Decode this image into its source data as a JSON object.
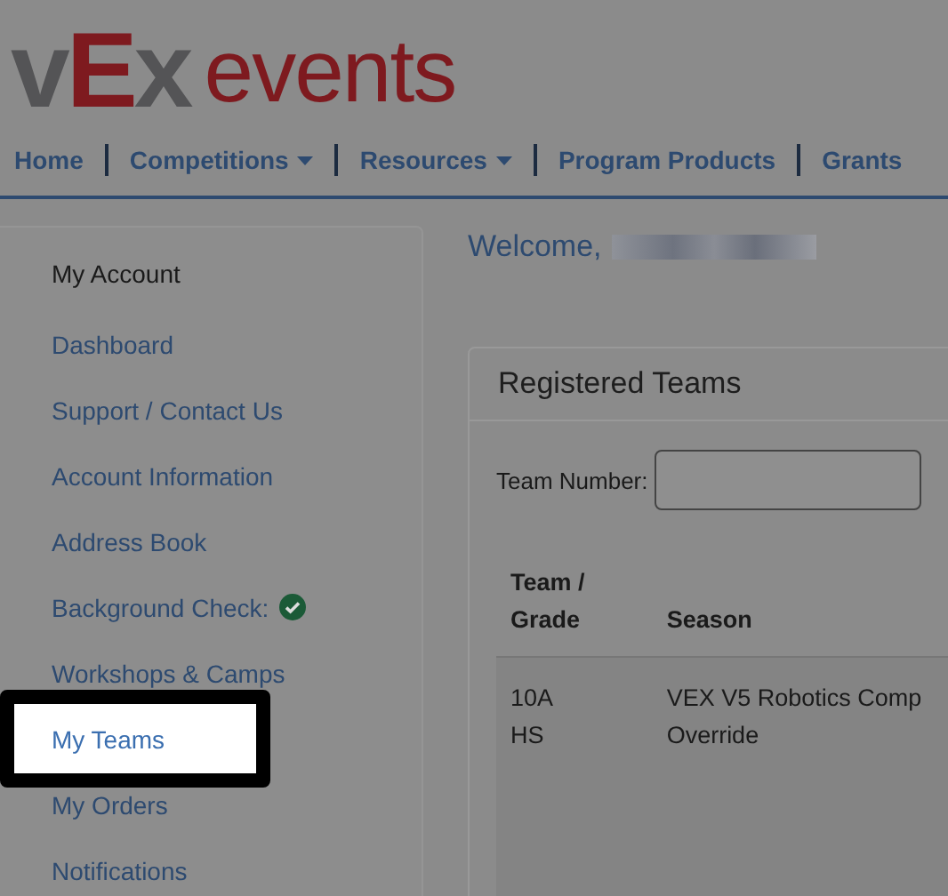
{
  "logo": {
    "parts": [
      {
        "text": "v",
        "color": "#545456"
      },
      {
        "text": "E",
        "color": "#7e1a1f"
      },
      {
        "text": "x",
        "color": "#545456"
      }
    ],
    "product": "events"
  },
  "nav": [
    {
      "label": "Home",
      "dropdown": false
    },
    {
      "label": "Competitions",
      "dropdown": true
    },
    {
      "label": "Resources",
      "dropdown": true
    },
    {
      "label": "Program Products",
      "dropdown": false
    },
    {
      "label": "Grants",
      "dropdown": false
    }
  ],
  "sidebar": {
    "heading": "My Account",
    "items": [
      {
        "label": "Dashboard",
        "verified": false,
        "selected": false
      },
      {
        "label": "Support / Contact Us",
        "verified": false,
        "selected": false
      },
      {
        "label": "Account Information",
        "verified": false,
        "selected": false
      },
      {
        "label": "Address Book",
        "verified": false,
        "selected": false
      },
      {
        "label": "Background Check:",
        "verified": true,
        "selected": false
      },
      {
        "label": "Workshops & Camps",
        "verified": false,
        "selected": false
      },
      {
        "label": "My Teams",
        "verified": false,
        "selected": true
      },
      {
        "label": "My Orders",
        "verified": false,
        "selected": false
      },
      {
        "label": "Notifications",
        "verified": false,
        "selected": false
      }
    ]
  },
  "welcome": "Welcome,",
  "card": {
    "title": "Registered Teams",
    "filter_label": "Team Number:",
    "columns": [
      "Team /\nGrade",
      "Season"
    ],
    "rows": [
      {
        "team": "10A",
        "grade": "HS",
        "season": "VEX V5 Robotics Comp",
        "game": "Override"
      }
    ]
  }
}
